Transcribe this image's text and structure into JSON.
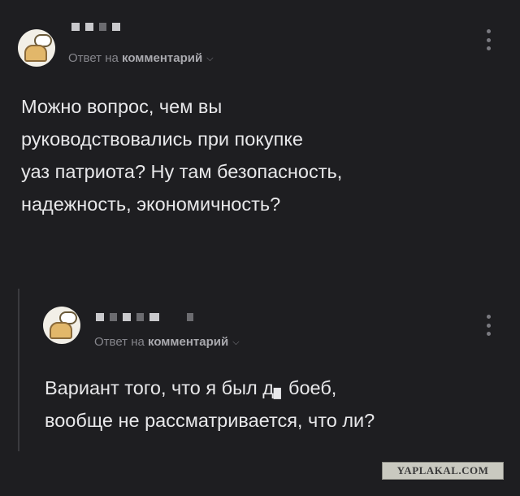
{
  "comments": [
    {
      "reply_label": "Ответ на",
      "reply_target": "комментарий",
      "text": "Можно вопрос, чем вы\nруководствовались при покупке\nуаз патриота? Ну там безопасность,\nнадежность, экономичность?"
    },
    {
      "reply_label": "Ответ на",
      "reply_target": "комментарий",
      "text": "Вариант того, что я был д▖боеб,\nвообще не рассматривается, что ли?"
    }
  ],
  "icons": {
    "avatar": "avatar-icon",
    "more": "more-vertical-icon",
    "chevron": "chevron-down-icon"
  },
  "watermark": "YAPLAKAL.COM",
  "colors": {
    "background": "#1e1e21",
    "text": "#e8e8ea",
    "meta": "#86868c"
  }
}
